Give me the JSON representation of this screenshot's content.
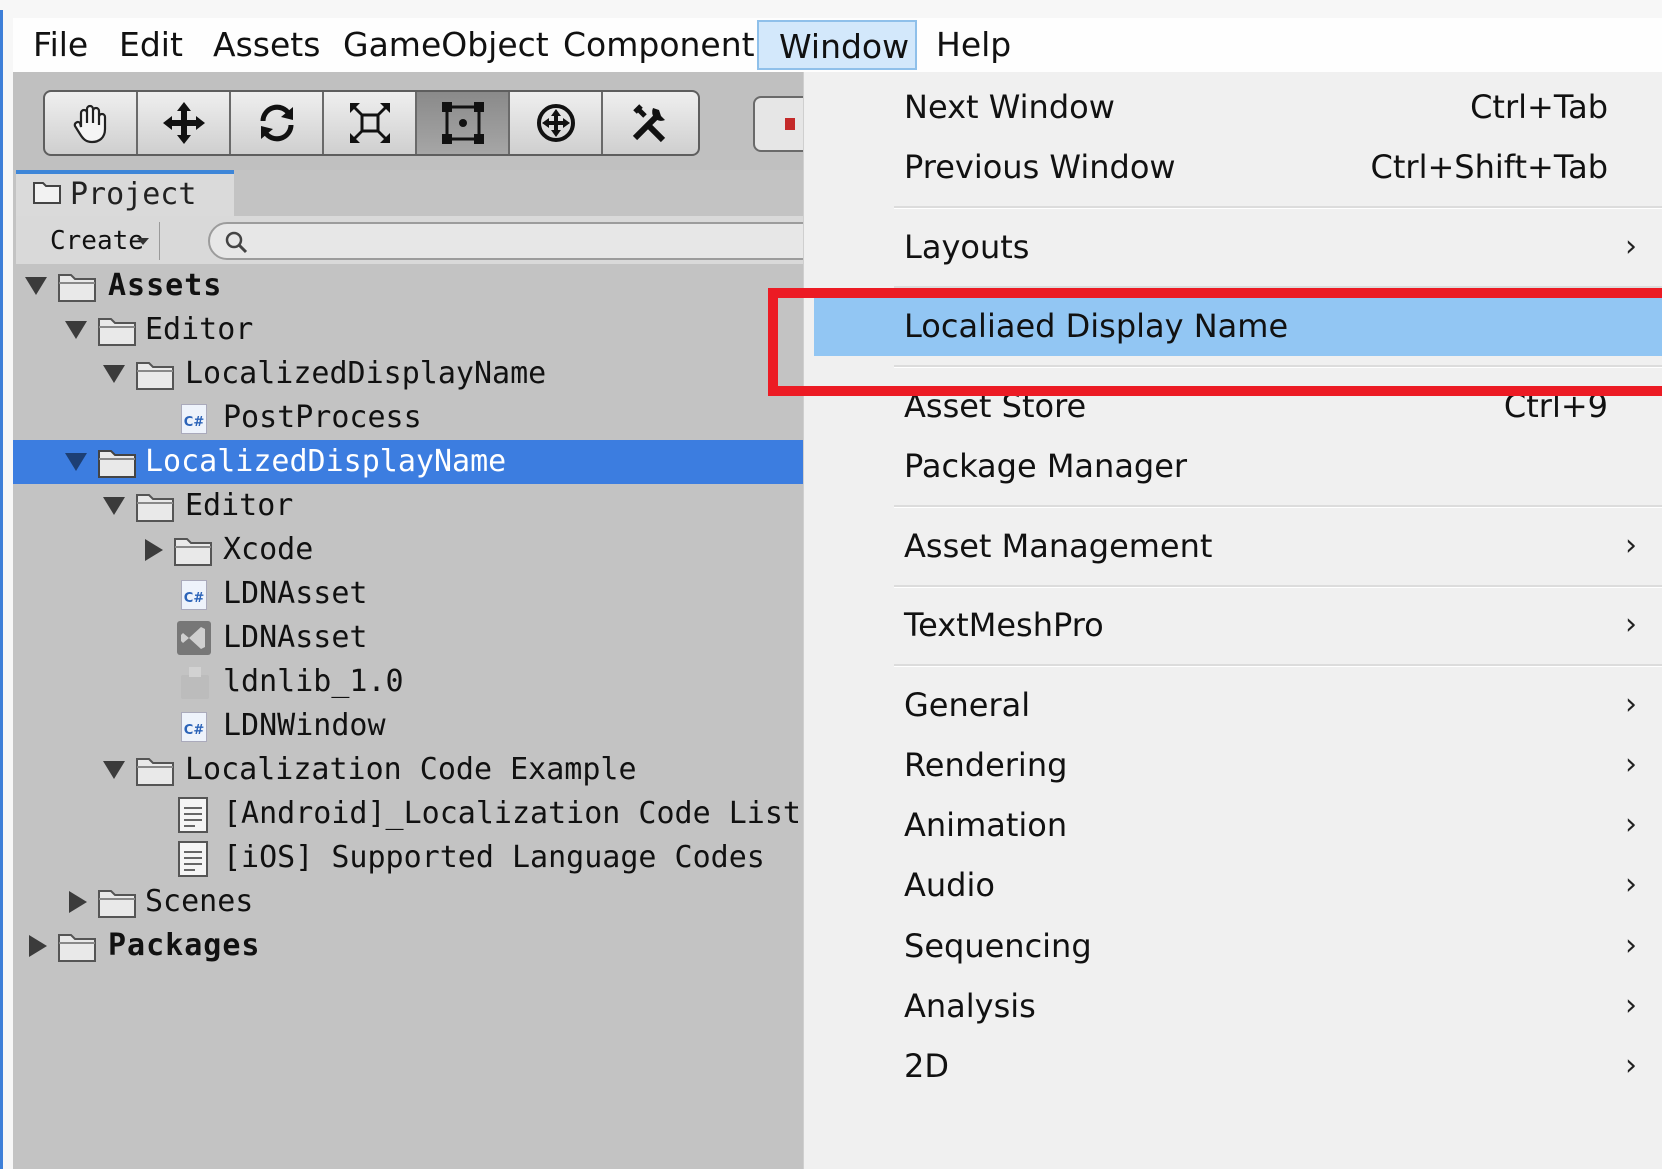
{
  "menubar": {
    "items": [
      {
        "label": "File"
      },
      {
        "label": "Edit"
      },
      {
        "label": "Assets"
      },
      {
        "label": "GameObject"
      },
      {
        "label": "Component"
      },
      {
        "label": "Window",
        "active": true
      },
      {
        "label": "Help"
      }
    ]
  },
  "toolbar": {
    "tools": [
      "hand-tool-icon",
      "move-tool-icon",
      "rotate-tool-icon",
      "scale-tool-icon",
      "rect-tool-icon",
      "transform-tool-icon",
      "custom-tool-icon"
    ],
    "pressed_index": 4
  },
  "project": {
    "tab_label": "Project",
    "create_label": "Create",
    "search_placeholder": ""
  },
  "tree": {
    "rows": [
      {
        "label": "Assets"
      },
      {
        "label": "Editor"
      },
      {
        "label": "LocalizedDisplayName"
      },
      {
        "label": "PostProcess"
      },
      {
        "label": "LocalizedDisplayName"
      },
      {
        "label": "Editor"
      },
      {
        "label": "Xcode"
      },
      {
        "label": "LDNAsset"
      },
      {
        "label": "LDNAsset"
      },
      {
        "label": "ldnlib_1.0"
      },
      {
        "label": "LDNWindow"
      },
      {
        "label": "Localization Code Example"
      },
      {
        "label": "[Android]_Localization Code List"
      },
      {
        "label": "[iOS] Supported Language Codes"
      },
      {
        "label": "Scenes"
      },
      {
        "label": "Packages"
      }
    ],
    "cs_badge": "C#"
  },
  "window_menu": {
    "items": [
      {
        "label": "Next Window",
        "shortcut": "Ctrl+Tab"
      },
      {
        "label": "Previous Window",
        "shortcut": "Ctrl+Shift+Tab"
      },
      {
        "label": "Layouts",
        "submenu": true
      },
      {
        "label": "Localiaed Display Name",
        "highlighted": true
      },
      {
        "label": "Asset Store",
        "shortcut": "Ctrl+9"
      },
      {
        "label": "Package Manager"
      },
      {
        "label": "Asset Management",
        "submenu": true
      },
      {
        "label": "TextMeshPro",
        "submenu": true
      },
      {
        "label": "General",
        "submenu": true
      },
      {
        "label": "Rendering",
        "submenu": true
      },
      {
        "label": "Animation",
        "submenu": true
      },
      {
        "label": "Audio",
        "submenu": true
      },
      {
        "label": "Sequencing",
        "submenu": true
      },
      {
        "label": "Analysis",
        "submenu": true
      },
      {
        "label": "2D",
        "submenu": true
      }
    ],
    "submenu_arrow": "›"
  },
  "colors": {
    "selection": "#3c7de0",
    "menu_highlight": "#92c6f3",
    "annotation_red": "#ec1b24"
  }
}
